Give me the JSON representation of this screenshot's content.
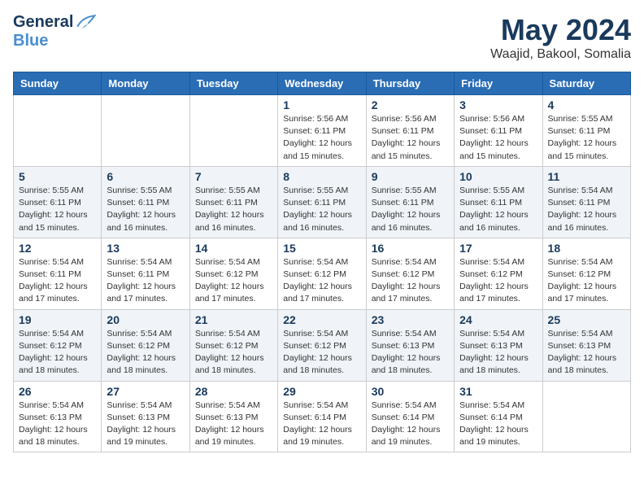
{
  "header": {
    "logo_general": "General",
    "logo_blue": "Blue",
    "title": "May 2024",
    "location": "Waajid, Bakool, Somalia"
  },
  "days_of_week": [
    "Sunday",
    "Monday",
    "Tuesday",
    "Wednesday",
    "Thursday",
    "Friday",
    "Saturday"
  ],
  "weeks": [
    [
      {
        "day": "",
        "info": ""
      },
      {
        "day": "",
        "info": ""
      },
      {
        "day": "",
        "info": ""
      },
      {
        "day": "1",
        "info": "Sunrise: 5:56 AM\nSunset: 6:11 PM\nDaylight: 12 hours\nand 15 minutes."
      },
      {
        "day": "2",
        "info": "Sunrise: 5:56 AM\nSunset: 6:11 PM\nDaylight: 12 hours\nand 15 minutes."
      },
      {
        "day": "3",
        "info": "Sunrise: 5:56 AM\nSunset: 6:11 PM\nDaylight: 12 hours\nand 15 minutes."
      },
      {
        "day": "4",
        "info": "Sunrise: 5:55 AM\nSunset: 6:11 PM\nDaylight: 12 hours\nand 15 minutes."
      }
    ],
    [
      {
        "day": "5",
        "info": "Sunrise: 5:55 AM\nSunset: 6:11 PM\nDaylight: 12 hours\nand 15 minutes."
      },
      {
        "day": "6",
        "info": "Sunrise: 5:55 AM\nSunset: 6:11 PM\nDaylight: 12 hours\nand 16 minutes."
      },
      {
        "day": "7",
        "info": "Sunrise: 5:55 AM\nSunset: 6:11 PM\nDaylight: 12 hours\nand 16 minutes."
      },
      {
        "day": "8",
        "info": "Sunrise: 5:55 AM\nSunset: 6:11 PM\nDaylight: 12 hours\nand 16 minutes."
      },
      {
        "day": "9",
        "info": "Sunrise: 5:55 AM\nSunset: 6:11 PM\nDaylight: 12 hours\nand 16 minutes."
      },
      {
        "day": "10",
        "info": "Sunrise: 5:55 AM\nSunset: 6:11 PM\nDaylight: 12 hours\nand 16 minutes."
      },
      {
        "day": "11",
        "info": "Sunrise: 5:54 AM\nSunset: 6:11 PM\nDaylight: 12 hours\nand 16 minutes."
      }
    ],
    [
      {
        "day": "12",
        "info": "Sunrise: 5:54 AM\nSunset: 6:11 PM\nDaylight: 12 hours\nand 17 minutes."
      },
      {
        "day": "13",
        "info": "Sunrise: 5:54 AM\nSunset: 6:11 PM\nDaylight: 12 hours\nand 17 minutes."
      },
      {
        "day": "14",
        "info": "Sunrise: 5:54 AM\nSunset: 6:12 PM\nDaylight: 12 hours\nand 17 minutes."
      },
      {
        "day": "15",
        "info": "Sunrise: 5:54 AM\nSunset: 6:12 PM\nDaylight: 12 hours\nand 17 minutes."
      },
      {
        "day": "16",
        "info": "Sunrise: 5:54 AM\nSunset: 6:12 PM\nDaylight: 12 hours\nand 17 minutes."
      },
      {
        "day": "17",
        "info": "Sunrise: 5:54 AM\nSunset: 6:12 PM\nDaylight: 12 hours\nand 17 minutes."
      },
      {
        "day": "18",
        "info": "Sunrise: 5:54 AM\nSunset: 6:12 PM\nDaylight: 12 hours\nand 17 minutes."
      }
    ],
    [
      {
        "day": "19",
        "info": "Sunrise: 5:54 AM\nSunset: 6:12 PM\nDaylight: 12 hours\nand 18 minutes."
      },
      {
        "day": "20",
        "info": "Sunrise: 5:54 AM\nSunset: 6:12 PM\nDaylight: 12 hours\nand 18 minutes."
      },
      {
        "day": "21",
        "info": "Sunrise: 5:54 AM\nSunset: 6:12 PM\nDaylight: 12 hours\nand 18 minutes."
      },
      {
        "day": "22",
        "info": "Sunrise: 5:54 AM\nSunset: 6:12 PM\nDaylight: 12 hours\nand 18 minutes."
      },
      {
        "day": "23",
        "info": "Sunrise: 5:54 AM\nSunset: 6:13 PM\nDaylight: 12 hours\nand 18 minutes."
      },
      {
        "day": "24",
        "info": "Sunrise: 5:54 AM\nSunset: 6:13 PM\nDaylight: 12 hours\nand 18 minutes."
      },
      {
        "day": "25",
        "info": "Sunrise: 5:54 AM\nSunset: 6:13 PM\nDaylight: 12 hours\nand 18 minutes."
      }
    ],
    [
      {
        "day": "26",
        "info": "Sunrise: 5:54 AM\nSunset: 6:13 PM\nDaylight: 12 hours\nand 18 minutes."
      },
      {
        "day": "27",
        "info": "Sunrise: 5:54 AM\nSunset: 6:13 PM\nDaylight: 12 hours\nand 19 minutes."
      },
      {
        "day": "28",
        "info": "Sunrise: 5:54 AM\nSunset: 6:13 PM\nDaylight: 12 hours\nand 19 minutes."
      },
      {
        "day": "29",
        "info": "Sunrise: 5:54 AM\nSunset: 6:14 PM\nDaylight: 12 hours\nand 19 minutes."
      },
      {
        "day": "30",
        "info": "Sunrise: 5:54 AM\nSunset: 6:14 PM\nDaylight: 12 hours\nand 19 minutes."
      },
      {
        "day": "31",
        "info": "Sunrise: 5:54 AM\nSunset: 6:14 PM\nDaylight: 12 hours\nand 19 minutes."
      },
      {
        "day": "",
        "info": ""
      }
    ]
  ]
}
